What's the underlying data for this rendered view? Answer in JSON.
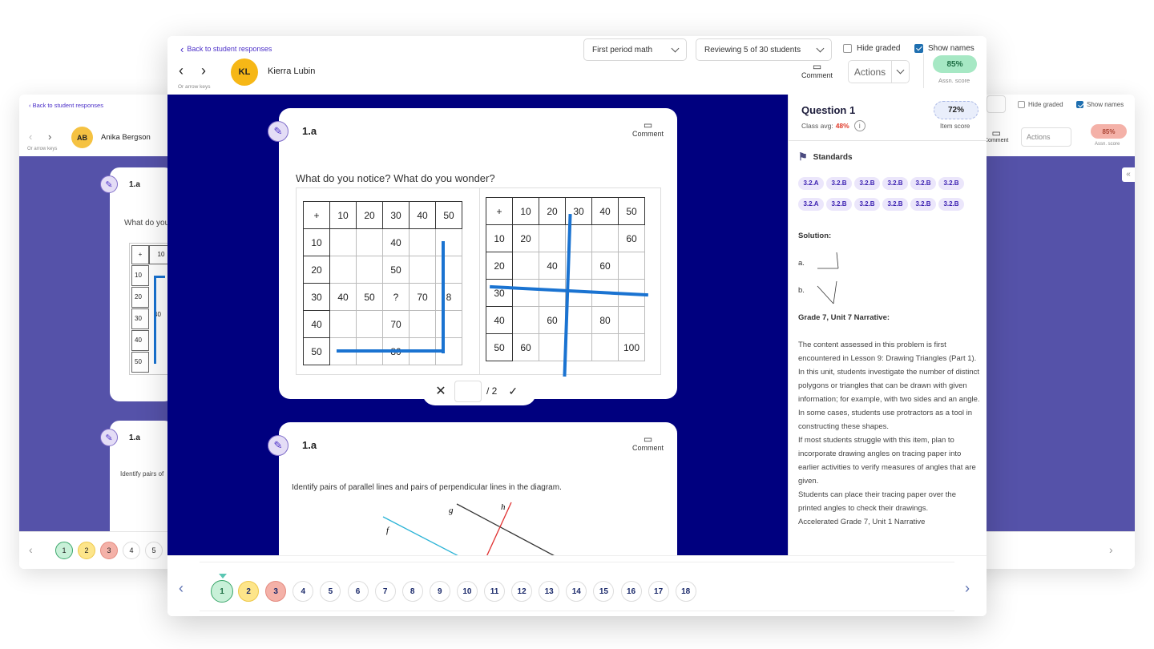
{
  "background_window": {
    "back_link": "Back to student responses",
    "arrow_hint": "Or arrow keys",
    "student_initials": "AB",
    "student_name": "Anika Bergson",
    "hide_graded": "Hide graded",
    "show_names": "Show names",
    "comment": "Comment",
    "actions": "Actions",
    "score": "85%",
    "score_label": "Assn. score",
    "card1_label": "1.a",
    "card1_prompt": "What do you",
    "card1_table": {
      "header": [
        "+",
        "10"
      ],
      "rows": [
        "10",
        "20",
        "30",
        "40",
        "50"
      ],
      "cell_30": "40"
    },
    "card2_label": "1.a",
    "card2_prompt": "Identify pairs of",
    "nav": [
      "1",
      "2",
      "3",
      "4",
      "5"
    ]
  },
  "header": {
    "back_link": "Back to student responses",
    "arrow_hint": "Or arrow keys",
    "student_initials": "KL",
    "student_name": "Kierra Lubin",
    "class_select": "First period math",
    "review_select": "Reviewing 5 of 30 students",
    "hide_graded": "Hide graded",
    "show_names": "Show names",
    "comment": "Comment",
    "actions": "Actions",
    "score": "85%",
    "score_label": "Assn. score"
  },
  "card1": {
    "label": "1.a",
    "comment": "Comment",
    "prompt": "What do you notice? What do you wonder?",
    "table1": {
      "header": [
        "+",
        "10",
        "20",
        "30",
        "40",
        "50"
      ],
      "rows": [
        [
          "10",
          "",
          "",
          "40",
          "",
          ""
        ],
        [
          "20",
          "",
          "",
          "50",
          "",
          ""
        ],
        [
          "30",
          "40",
          "50",
          "?",
          "70",
          "8"
        ],
        [
          "40",
          "",
          "",
          "70",
          "",
          ""
        ],
        [
          "50",
          "",
          "",
          "80",
          "",
          ""
        ]
      ]
    },
    "table2": {
      "header": [
        "+",
        "10",
        "20",
        "30",
        "40",
        "50"
      ],
      "rows": [
        [
          "10",
          "20",
          "",
          "",
          "",
          "60"
        ],
        [
          "20",
          "",
          "40",
          "",
          "60",
          ""
        ],
        [
          "30",
          "",
          "",
          "",
          "",
          ""
        ],
        [
          "40",
          "",
          "60",
          "",
          "80",
          ""
        ],
        [
          "50",
          "60",
          "",
          "",
          "",
          "100"
        ]
      ]
    },
    "grade_denominator": "/ 2"
  },
  "card2": {
    "label": "1.a",
    "comment": "Comment",
    "prompt": "Identify pairs of parallel lines and pairs of perpendicular lines in the diagram.",
    "line_labels": [
      "f",
      "g",
      "h"
    ]
  },
  "sidebar": {
    "question_title": "Question 1",
    "class_avg_label": "Class avg:",
    "class_avg_value": "48%",
    "item_score": "72%",
    "item_score_label": "Item score",
    "standards_label": "Standards",
    "standards": [
      "3.2.A",
      "3.2.B",
      "3.2.B",
      "3.2.B",
      "3.2.B",
      "3.2.B",
      "3.2.A",
      "3.2.B",
      "3.2.B",
      "3.2.B",
      "3.2.B",
      "3.2.B"
    ],
    "solution_label": "Solution:",
    "solution_a": "a.",
    "solution_b": "b.",
    "narrative_title": "Grade 7, Unit 7 Narrative:",
    "paragraphs": [
      "The content assessed in this problem is first encountered in Lesson 9: Drawing Triangles (Part 1).",
      "In this unit, students investigate the number of distinct polygons or triangles that can be drawn with given information; for example, with two sides and an angle.",
      "In some cases, students use protractors as a tool in constructing these shapes.",
      "If most students struggle with this item, plan to incorporate drawing angles on tracing paper into earlier activities to verify measures of angles that are given.",
      "Students can place their tracing paper over the printed angles to check their drawings.",
      "Accelerated Grade 7, Unit 1 Narrative"
    ]
  },
  "footer": {
    "questions": [
      "1",
      "2",
      "3",
      "4",
      "5",
      "6",
      "7",
      "8",
      "9",
      "10",
      "11",
      "12",
      "13",
      "14",
      "15",
      "16",
      "17",
      "18"
    ]
  },
  "colors": {
    "accent": "#4b2fc8",
    "main_bg": "#00007f",
    "bg_main": "#5552a9",
    "good": "#a6e8c4",
    "warn": "#fde58a",
    "bad": "#f4b1a8"
  }
}
